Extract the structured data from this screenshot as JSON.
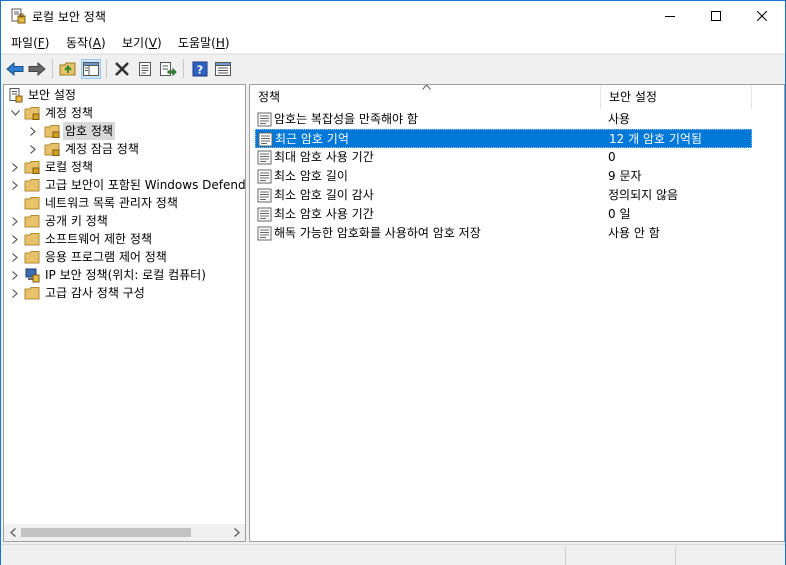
{
  "window": {
    "title": "로컬 보안 정책"
  },
  "menu": [
    {
      "label": "파일",
      "key": "F"
    },
    {
      "label": "동작",
      "key": "A"
    },
    {
      "label": "보기",
      "key": "V"
    },
    {
      "label": "도움말",
      "key": "H"
    }
  ],
  "tree": {
    "root": "보안 설정",
    "items": [
      {
        "label": "계정 정책"
      },
      {
        "label": "암호 정책"
      },
      {
        "label": "계정 잠금 정책"
      },
      {
        "label": "로컬 정책"
      },
      {
        "label": "고급 보안이 포함된 Windows Defender 방화벽"
      },
      {
        "label": "네트워크 목록 관리자 정책"
      },
      {
        "label": "공개 키 정책"
      },
      {
        "label": "소프트웨어 제한 정책"
      },
      {
        "label": "응용 프로그램 제어 정책"
      },
      {
        "label": "IP 보안 정책(위치: 로컬 컴퓨터)"
      },
      {
        "label": "고급 감사 정책 구성"
      }
    ]
  },
  "list": {
    "columns": [
      "정책",
      "보안 설정"
    ],
    "rows": [
      {
        "policy": "암호는 복잡성을 만족해야 함",
        "value": "사용"
      },
      {
        "policy": "최근 암호 기억",
        "value": "12 개 암호 기억됨"
      },
      {
        "policy": "최대 암호 사용 기간",
        "value": "0"
      },
      {
        "policy": "최소 암호 길이",
        "value": "9 문자"
      },
      {
        "policy": "최소 암호 길이 감사",
        "value": "정의되지 않음"
      },
      {
        "policy": "최소 암호 사용 기간",
        "value": "0 일"
      },
      {
        "policy": "해독 가능한 암호화를 사용하여 암호 저장",
        "value": "사용 안 함"
      }
    ]
  },
  "colors": {
    "accent": "#0078d7",
    "selection_inactive": "#d9d9d9",
    "folder": "#e8c26a"
  },
  "icons": [
    "app-icon",
    "back-icon",
    "forward-icon",
    "up-folder-icon",
    "show-hide-tree-icon",
    "delete-icon",
    "properties-icon",
    "export-icon",
    "help-icon",
    "mmc-view-icon",
    "folder-icon",
    "policy-icon"
  ]
}
